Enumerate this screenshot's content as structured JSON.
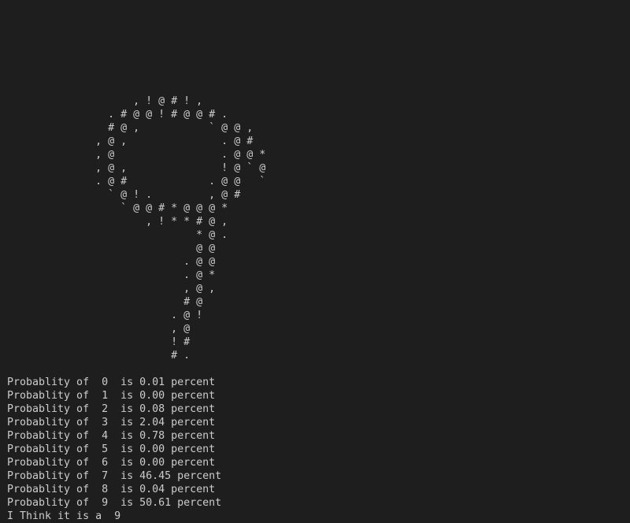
{
  "terminal": {
    "ascii_art": [
      "                    , ! @ # ! ,",
      "                . # @ @ ! # @ @ # .",
      "                # @ ,           ` @ @ ,",
      "              , @ ,               . @ #",
      "              , @                 . @ @ *",
      "              , @ ,               ! @ ` @",
      "              . @ #             . @ @   `",
      "                ` @ ! .         , @ #",
      "                  ` @ @ # * @ @ @ *",
      "                      , ! * * # @ ,",
      "                              * @ .",
      "                              @ @",
      "                            . @ @",
      "                            . @ *",
      "                            , @ ,",
      "                            # @",
      "                          . @ !",
      "                          , @",
      "                          ! #",
      "                          # ."
    ],
    "output_lines": [
      "Probablity of  0  is 0.01 percent",
      "Probablity of  1  is 0.00 percent",
      "Probablity of  2  is 0.08 percent",
      "Probablity of  3  is 2.04 percent",
      "Probablity of  4  is 0.78 percent",
      "Probablity of  5  is 0.00 percent",
      "Probablity of  6  is 0.00 percent",
      "Probablity of  7  is 46.45 percent",
      "Probablity of  8  is 0.04 percent",
      "Probablity of  9  is 50.61 percent",
      "I Think it is a  9"
    ],
    "colors": {
      "background": "#1e1e1e",
      "text": "#cccccc"
    }
  }
}
